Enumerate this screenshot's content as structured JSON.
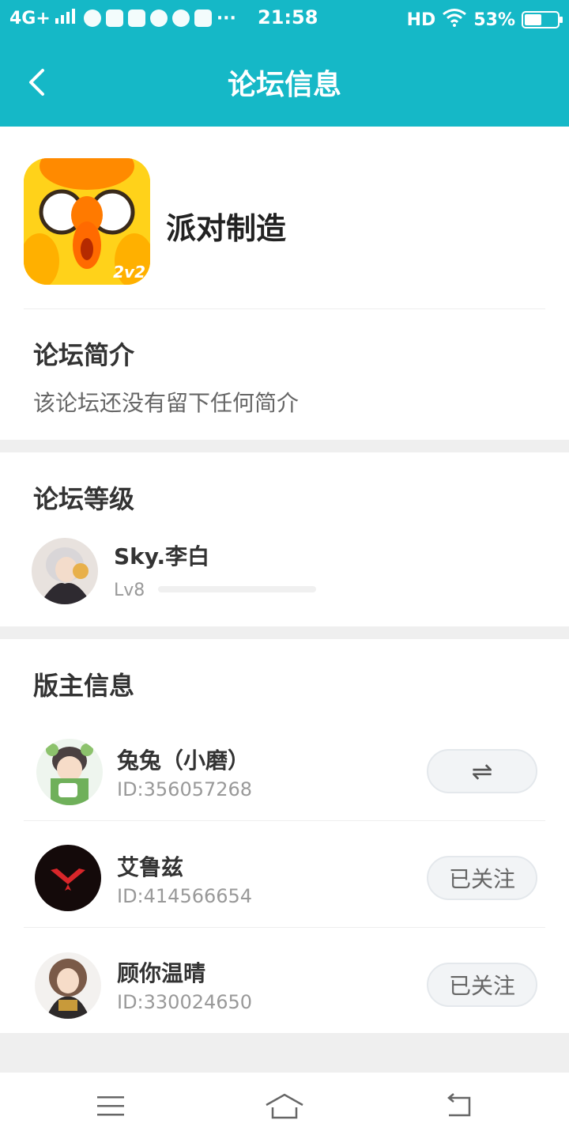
{
  "status_bar": {
    "network": "4G+",
    "time": "21:58",
    "hd": "HD",
    "battery": "53%",
    "battery_level": 0.53
  },
  "header": {
    "title": "论坛信息"
  },
  "forum": {
    "name": "派对制造",
    "logo_badge": "2v2"
  },
  "intro": {
    "title": "论坛简介",
    "text": "该论坛还没有留下任何简介"
  },
  "level": {
    "title": "论坛等级",
    "user_name": "Sky.李白",
    "level_label": "Lv8",
    "progress": 0
  },
  "moderators": {
    "title": "版主信息",
    "items": [
      {
        "name": "兔兔（小磨）",
        "id": "ID:356057268",
        "action": "⇌",
        "action_icon": "switch-icon"
      },
      {
        "name": "艾鲁兹",
        "id": "ID:414566654",
        "action": "已关注"
      },
      {
        "name": "顾你温晴",
        "id": "ID:330024650",
        "action": "已关注"
      }
    ]
  },
  "colors": {
    "accent": "#15b8c7",
    "background_gap": "#efefef"
  }
}
